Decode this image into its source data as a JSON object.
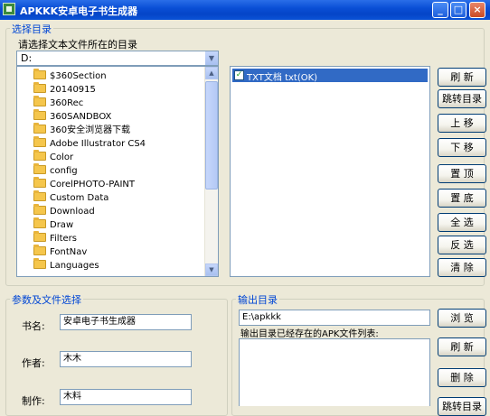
{
  "window": {
    "title": "APKKK安卓电子书生成器",
    "buttons": {
      "minimize": "_",
      "maximize": "□",
      "close": "×"
    }
  },
  "select_dir": {
    "group_title": "选择目录",
    "prompt": "请选择文本文件所在的目录",
    "drive": "D:",
    "folders": [
      "$360Section",
      "20140915",
      "360Rec",
      "360SANDBOX",
      "360安全浏览器下载",
      "Adobe Illustrator CS4",
      "Color",
      "config",
      "CorelPHOTO-PAINT",
      "Custom Data",
      "Download",
      "Draw",
      "Filters",
      "FontNav",
      "Languages"
    ],
    "files": [
      {
        "label": "TXT文档 txt(OK)",
        "checked": true,
        "selected": true
      }
    ],
    "buttons": [
      "刷 新",
      "跳转目录",
      "上 移",
      "下 移",
      "置 顶",
      "置 底",
      "全 选",
      "反 选",
      "清 除"
    ]
  },
  "params": {
    "group_title": "参数及文件选择",
    "book_name_label": "书名:",
    "book_name_value": "安卓电子书生成器",
    "author_label": "作者:",
    "author_value": "木木",
    "maker_label": "制作:",
    "maker_value": "木料"
  },
  "output": {
    "group_title": "输出目录",
    "path": "E:\\apkkk",
    "browse_label": "浏 览",
    "existing_label": "输出目录已经存在的APK文件列表:",
    "buttons": [
      "刷 新",
      "删 除",
      "跳转目录"
    ]
  },
  "colors": {
    "title_bar": "#0A4FD6",
    "group_title": "#0046D5",
    "selection": "#316AC5",
    "window_bg": "#ECE9D8"
  },
  "icons": [
    "app-icon",
    "folder-icon",
    "checkbox-icon",
    "scroll-up-icon",
    "scroll-down-icon",
    "combo-arrow-icon"
  ]
}
